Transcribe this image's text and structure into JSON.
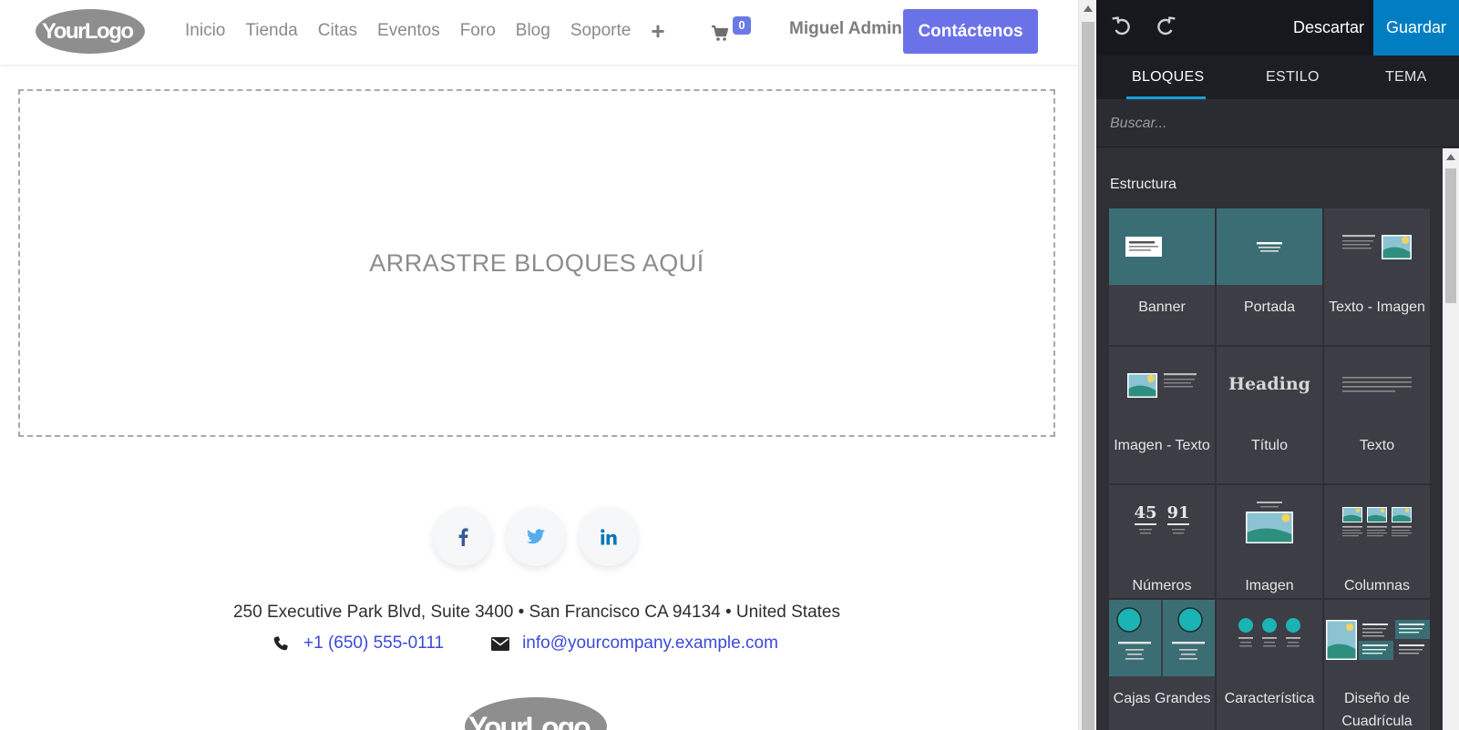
{
  "site": {
    "logo_text": "YourLogo",
    "nav": [
      {
        "label": "Inicio"
      },
      {
        "label": "Tienda"
      },
      {
        "label": "Citas"
      },
      {
        "label": "Eventos"
      },
      {
        "label": "Foro"
      },
      {
        "label": "Blog"
      },
      {
        "label": "Soporte"
      }
    ],
    "nav_plus": "+",
    "cart_count": "0",
    "user_name": "Miguel Admin",
    "contact_button": "Contáctenos",
    "dropzone_text": "ARRASTRE BLOQUES AQUÍ",
    "socials": [
      {
        "name": "facebook-icon",
        "glyph": "f",
        "color": "#3b5998"
      },
      {
        "name": "twitter-icon",
        "glyph": "t",
        "color": "#55acee"
      },
      {
        "name": "linkedin-icon",
        "glyph": "in",
        "color": "#0976b4"
      }
    ],
    "address": "250 Executive Park Blvd, Suite 3400 • San Francisco CA 94134 • United States",
    "phone": "+1 (650) 555-0111",
    "email": "info@yourcompany.example.com",
    "accent_color": "#6b72e8"
  },
  "editor": {
    "discard_label": "Descartar",
    "save_label": "Guardar",
    "tabs": [
      {
        "label": "BLOQUES",
        "active": true
      },
      {
        "label": "ESTILO",
        "active": false
      },
      {
        "label": "TEMA",
        "active": false
      }
    ],
    "search_placeholder": "Buscar...",
    "section_title": "Estructura",
    "blocks": [
      {
        "label": "Banner",
        "thumb": "banner"
      },
      {
        "label": "Portada",
        "thumb": "cover"
      },
      {
        "label": "Texto - Imagen",
        "thumb": "text-image"
      },
      {
        "label": "Imagen - Texto",
        "thumb": "image-text"
      },
      {
        "label": "Título",
        "thumb": "heading",
        "thumb_text": "Heading"
      },
      {
        "label": "Texto",
        "thumb": "text"
      },
      {
        "label": "Números",
        "thumb": "numbers",
        "thumb_text_a": "45",
        "thumb_text_b": "91"
      },
      {
        "label": "Imagen",
        "thumb": "image"
      },
      {
        "label": "Columnas",
        "thumb": "columns"
      },
      {
        "label": "Cajas Grandes",
        "thumb": "big-boxes"
      },
      {
        "label": "Característica",
        "thumb": "features"
      },
      {
        "label": "Diseño de Cuadrícula",
        "thumb": "grid"
      }
    ],
    "save_color": "#017ec2",
    "tab_indicator_color": "#1a9fd8"
  }
}
